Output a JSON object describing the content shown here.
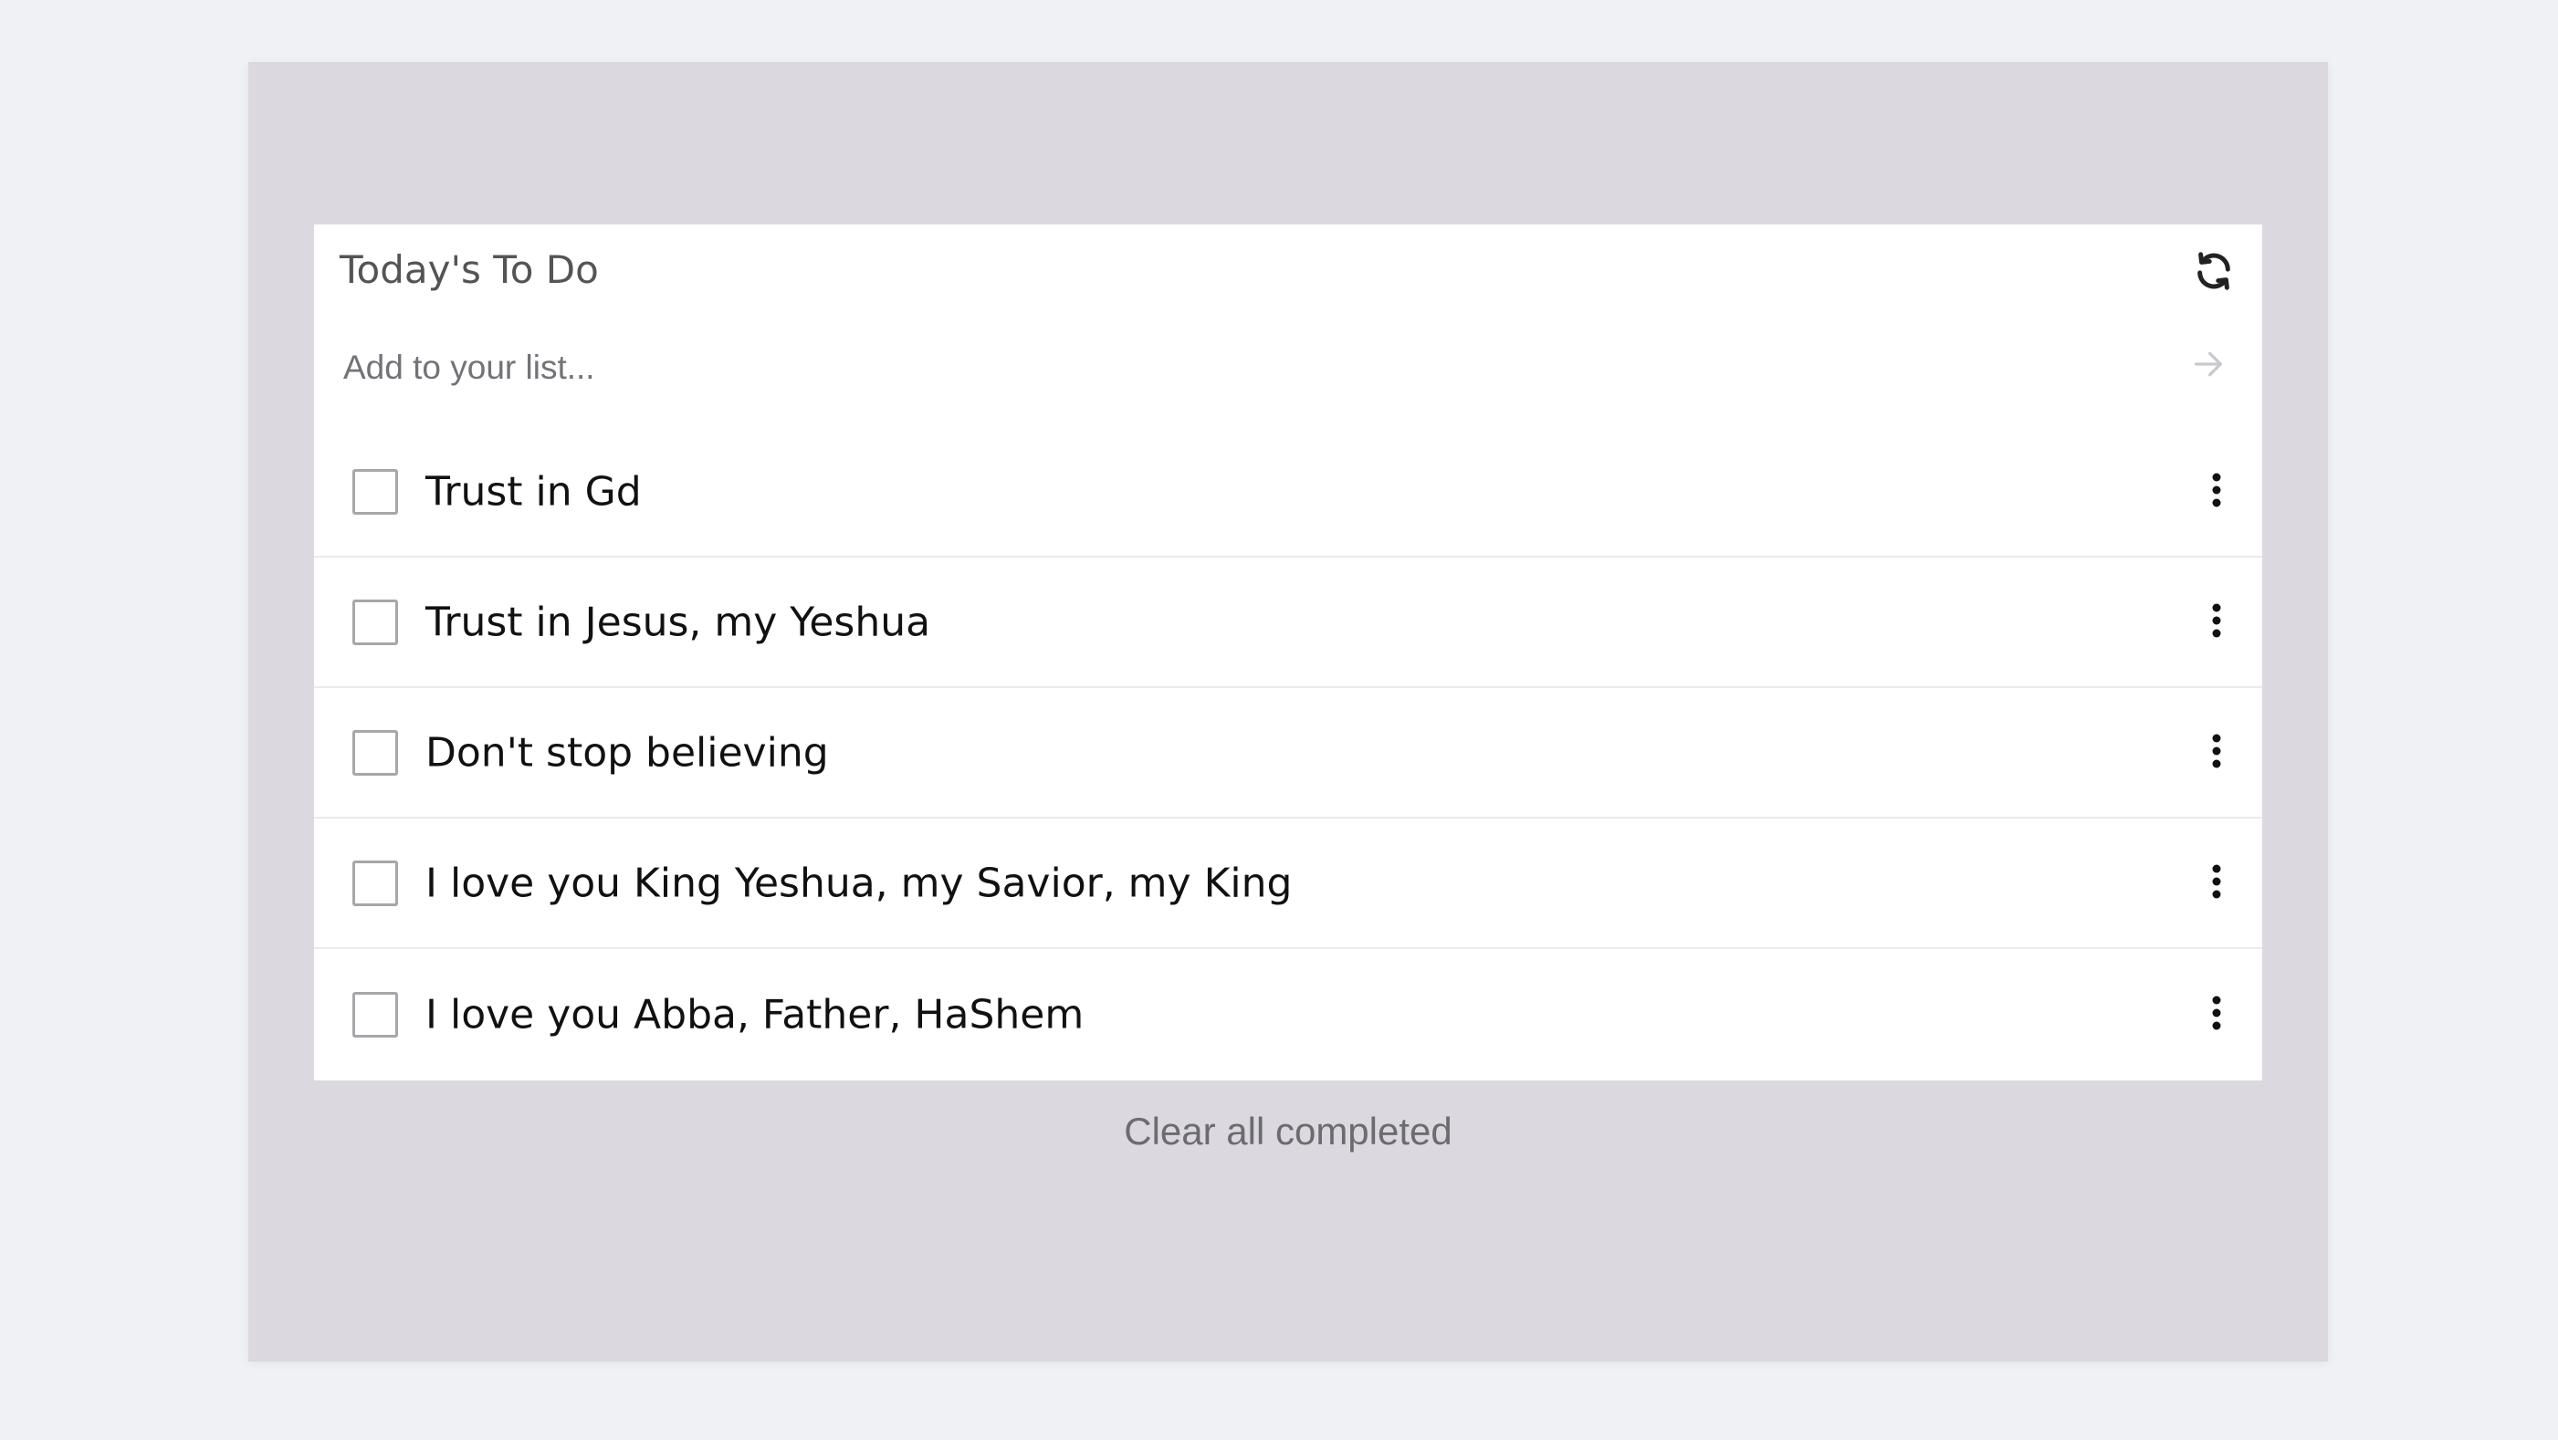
{
  "card": {
    "title": "Today's To Do",
    "refresh_icon": "refresh-icon",
    "submit_icon": "arrow-right-icon"
  },
  "add_input": {
    "placeholder": "Add to your list...",
    "value": ""
  },
  "items": [
    {
      "text": "Trust in Gd",
      "checked": false
    },
    {
      "text": "Trust in Jesus, my Yeshua",
      "checked": false
    },
    {
      "text": "Don't stop believing",
      "checked": false
    },
    {
      "text": "I love you King Yeshua, my Savior, my King",
      "checked": false
    },
    {
      "text": "I love you Abba, Father, HaShem",
      "checked": false
    }
  ],
  "footer": {
    "clear_label": "Clear all completed"
  },
  "colors": {
    "page_background": "#f0f1f5",
    "panel_background": "#dbd8df",
    "card_background": "#ffffff",
    "checkbox_border": "#a6a6ab"
  }
}
